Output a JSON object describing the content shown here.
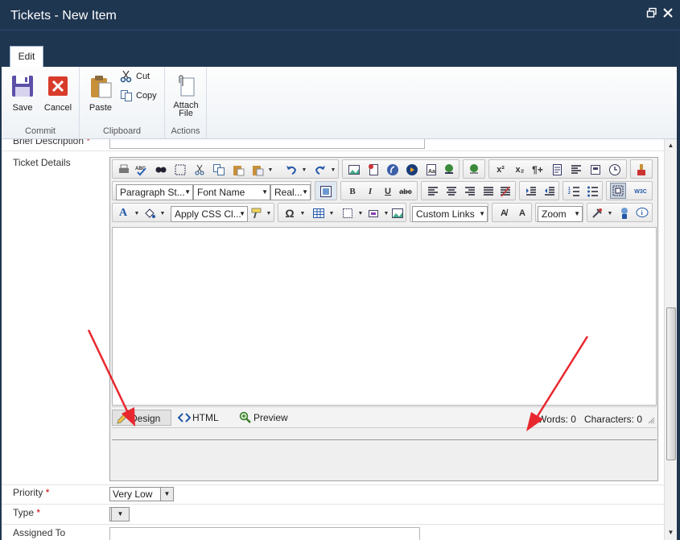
{
  "window": {
    "title": "Tickets - New Item",
    "restore_icon": "restore-icon",
    "close_icon": "close-icon"
  },
  "ribbon": {
    "tab": "Edit",
    "groups": {
      "commit": "Commit",
      "clipboard": "Clipboard",
      "actions": "Actions"
    },
    "save": "Save",
    "cancel": "Cancel",
    "paste": "Paste",
    "cut": "Cut",
    "copy": "Copy",
    "attach_line1": "Attach",
    "attach_line2": "File"
  },
  "form": {
    "brief_description": "Brief Description",
    "ticket_details": "Ticket Details",
    "priority": "Priority",
    "priority_value": "Very Low",
    "type": "Type",
    "type_value": "",
    "assigned_to": "Assigned To",
    "required_mark": "*"
  },
  "editor": {
    "paragraph_style": "Paragraph St...",
    "font_name": "Font Name",
    "font_size": "Real...",
    "apply_css": "Apply CSS Cl...",
    "custom_links": "Custom Links",
    "zoom": "Zoom",
    "modes": {
      "design": "Design",
      "html": "HTML",
      "preview": "Preview"
    },
    "words": "Words: 0",
    "characters": "Characters: 0"
  },
  "colors": {
    "title_bar": "#1f3651",
    "annotation_arrow": "#e8282e",
    "required": "#cc0000"
  }
}
